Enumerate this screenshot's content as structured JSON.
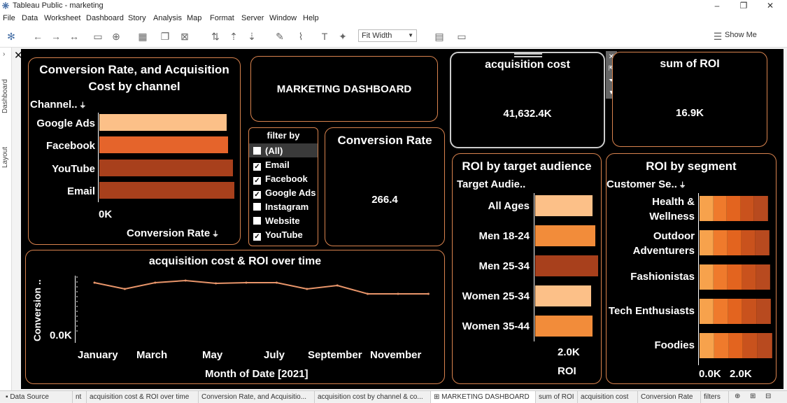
{
  "window": {
    "title": "Tableau Public - marketing"
  },
  "menu": [
    "File",
    "Data",
    "Worksheet",
    "Dashboard",
    "Story",
    "Analysis",
    "Map",
    "Format",
    "Server",
    "Window",
    "Help"
  ],
  "toolbar": {
    "fit_width": "Fit Width",
    "show_me": "Show Me"
  },
  "side_tabs": {
    "dashboard": "Dashboard",
    "layout": "Layout"
  },
  "panels": {
    "conv_by_channel": {
      "title_line1": "Conversion Rate, and Acquisition",
      "title_line2": "Cost by channel",
      "row_header": "Channel..",
      "categories": [
        "Google Ads",
        "Facebook",
        "YouTube",
        "Email"
      ],
      "zero_label": "0K",
      "x_label": "Conversion Rate"
    },
    "marketing_title": "MARKETING DASHBOARD",
    "filter": {
      "title": "filter by",
      "items": [
        {
          "label": "(All)",
          "checked": false
        },
        {
          "label": "Email",
          "checked": true
        },
        {
          "label": "Facebook",
          "checked": true
        },
        {
          "label": "Google Ads",
          "checked": true
        },
        {
          "label": "Instagram",
          "checked": false
        },
        {
          "label": "Website",
          "checked": false
        },
        {
          "label": "YouTube",
          "checked": true
        }
      ]
    },
    "conversion_rate": {
      "title": "Conversion Rate",
      "value": "266.4"
    },
    "acq_cost": {
      "title": "acquisition cost",
      "value": "41,632.4K"
    },
    "sum_roi": {
      "title": "sum of ROI",
      "value": "16.9K"
    },
    "roi_target": {
      "title": "ROI by target audience",
      "row_header": "Target Audie..",
      "categories": [
        "All Ages",
        "Men 18-24",
        "Men 25-34",
        "Women 25-34",
        "Women 35-44"
      ],
      "tick": "2.0K",
      "x_label": "ROI"
    },
    "roi_segment": {
      "title": "ROI by segment",
      "row_header": "Customer Se..",
      "categories": [
        [
          "Health &",
          "Wellness"
        ],
        [
          "Outdoor",
          "Adventurers"
        ],
        [
          "Fashionistas"
        ],
        [
          "Tech Enthusiasts"
        ],
        [
          "Foodies"
        ]
      ],
      "ticks": [
        "0.0K",
        "2.0K"
      ]
    },
    "over_time": {
      "title": "acquisition cost & ROI over time",
      "y_label": "Conversion ..",
      "y_zero": "0.0K",
      "x_ticks": [
        "January",
        "March",
        "May",
        "July",
        "September",
        "November"
      ],
      "x_label": "Month of Date [2021]"
    }
  },
  "sheet_tabs": [
    "Data Source",
    "nt",
    "acquisition cost & ROI over time",
    "Conversion Rate, and Acquisitio...",
    "acquisition cost by channel & co...",
    "MARKETING DASHBOARD",
    "sum of ROI",
    "acquisition cost",
    "Conversion Rate",
    "filters"
  ],
  "chart_data": [
    {
      "type": "bar",
      "title": "Conversion Rate, and Acquisition Cost by channel",
      "categories": [
        "Google Ads",
        "Facebook",
        "YouTube",
        "Email"
      ],
      "values": [
        0.85,
        0.84,
        0.88,
        0.88
      ],
      "colors": [
        "#fcc088",
        "#e5642b",
        "#a8401c",
        "#a8401c"
      ],
      "xlabel": "Conversion Rate"
    },
    {
      "type": "bar",
      "title": "ROI by target audience",
      "categories": [
        "All Ages",
        "Men 18-24",
        "Men 25-34",
        "Women 25-34",
        "Women 35-44"
      ],
      "values": [
        2.0,
        2.1,
        2.2,
        1.95,
        2.0
      ],
      "colors": [
        "#fcc088",
        "#f28c3a",
        "#a8401c",
        "#fcc088",
        "#f28c3a"
      ],
      "xlabel": "ROI"
    },
    {
      "type": "bar",
      "title": "ROI by segment",
      "categories": [
        "Health & Wellness",
        "Outdoor Adventurers",
        "Fashionistas",
        "Tech Enthusiasts",
        "Foodies"
      ],
      "values": [
        2.4,
        2.5,
        2.5,
        2.5,
        2.6
      ],
      "stack_colors": [
        "#f7a24c",
        "#ef7a2c",
        "#e3641f",
        "#c9521d",
        "#b84a1f"
      ]
    },
    {
      "type": "line",
      "title": "acquisition cost & ROI over time",
      "x": [
        "Jan",
        "Feb",
        "Mar",
        "Apr",
        "May",
        "Jun",
        "Jul",
        "Aug",
        "Sep",
        "Oct",
        "Nov",
        "Dec"
      ],
      "values": [
        0.86,
        0.77,
        0.86,
        0.89,
        0.85,
        0.86,
        0.86,
        0.77,
        0.82,
        0.7,
        0.7,
        0.7
      ],
      "xlabel": "Month of Date [2021]",
      "ylabel": "Conversion .."
    }
  ]
}
